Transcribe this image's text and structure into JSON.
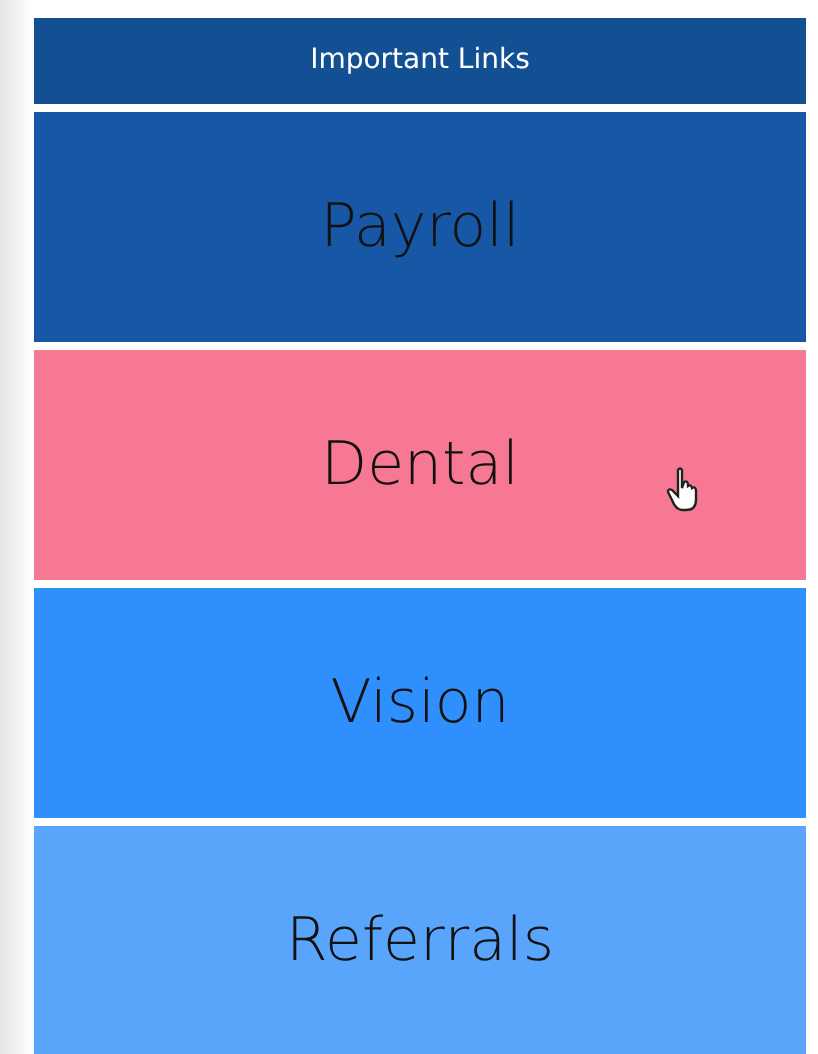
{
  "panel": {
    "title": "Important Links"
  },
  "links": [
    {
      "label": "Payroll",
      "color": "#1657a6",
      "hovered": false
    },
    {
      "label": "Dental",
      "color": "#f77892",
      "hovered": true
    },
    {
      "label": "Vision",
      "color": "#2f90fd",
      "hovered": false
    },
    {
      "label": "Referrals",
      "color": "#5aa5fc",
      "hovered": false
    }
  ]
}
